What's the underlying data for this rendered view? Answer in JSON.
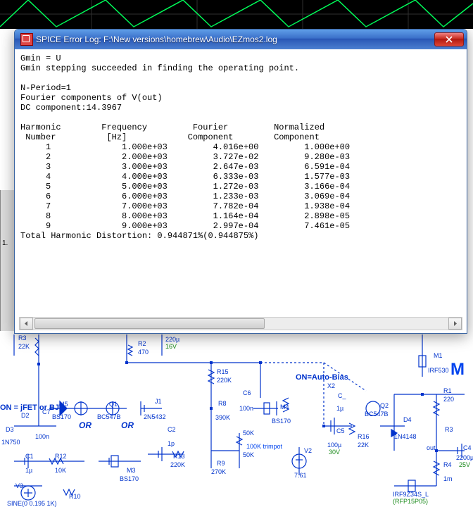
{
  "window": {
    "title": "SPICE Error Log: F:\\New versions\\homebrew\\Audio\\EZmos2.log"
  },
  "log": {
    "gmin": "Gmin = U",
    "gmin_step": "Gmin stepping succeeded in finding the operating point.",
    "nperiod": "N-Period=1",
    "fourier_of": "Fourier components of V(out)",
    "dc": "DC component:14.3967",
    "thd": "Total Harmonic Distortion: 0.944871%(0.944875%)"
  },
  "table": {
    "h1": "Harmonic",
    "h2": "Frequency",
    "h3": "Fourier",
    "h4": "Normalized",
    "u1": " Number",
    "u2": "[Hz]",
    "u3": "Component",
    "u4": "Component",
    "rows": [
      {
        "n": "1",
        "f": "1.000e+03",
        "c": "4.016e+00",
        "r": "1.000e+00"
      },
      {
        "n": "2",
        "f": "2.000e+03",
        "c": "3.727e-02",
        "r": "9.280e-03"
      },
      {
        "n": "3",
        "f": "3.000e+03",
        "c": "2.647e-03",
        "r": "6.591e-04"
      },
      {
        "n": "4",
        "f": "4.000e+03",
        "c": "6.333e-03",
        "r": "1.577e-03"
      },
      {
        "n": "5",
        "f": "5.000e+03",
        "c": "1.272e-03",
        "r": "3.166e-04"
      },
      {
        "n": "6",
        "f": "6.000e+03",
        "c": "1.233e-03",
        "r": "3.069e-04"
      },
      {
        "n": "7",
        "f": "7.000e+03",
        "c": "7.782e-04",
        "r": "1.938e-04"
      },
      {
        "n": "8",
        "f": "8.000e+03",
        "c": "1.164e-04",
        "r": "2.898e-05"
      },
      {
        "n": "9",
        "f": "9.000e+03",
        "c": "2.997e-04",
        "r": "7.461e-05"
      }
    ]
  },
  "scope": {
    "tick1": "1."
  },
  "schem": {
    "r3": "R3",
    "r3v": "22K",
    "r2": "R2",
    "r2v": "470",
    "c_220u": "220µ",
    "c_220uv": "16V",
    "r15": "R15",
    "r15v": "220K",
    "m1": "M1",
    "m1p": "IRF530",
    "autobias": "ON=Auto-Bias",
    "x2": "X2",
    "r1": "R1",
    "r1v": "220",
    "q2": "Q2",
    "q2p": "BC547B",
    "d4": "D4",
    "d4p": "1N4148",
    "r33": "R3",
    "out": "out",
    "c4": "C4",
    "c4v": "2200µ",
    "c4v2": "25V",
    "r4": "R4",
    "r4v": "1m",
    "r16": "R16",
    "r16v": "22K",
    "c5": "C5",
    "c5v": "100µ",
    "c5v2": "30V",
    "v2": "V2",
    "v2v": "7.61",
    "trimpot": "100K trimpot",
    "m4": "M4",
    "m4p": "BS170",
    "r8": "R8",
    "r8v": "390K",
    "c6": "C6",
    "c6v": "100n",
    "c_": "C_",
    "c_v": "1µ",
    "r9": "R9",
    "r9v": "270K",
    "c2": "C2",
    "c2v": "1p",
    "r13": "R13",
    "r13v": "220K",
    "r_50k": "50K",
    "r_50k2": "50K",
    "on_jfet": "ON = jFET or BJT",
    "m5": "M5",
    "m5p": "BS170",
    "q1": "Q1",
    "q1p": "BC547B",
    "j1": "J1",
    "j1p": "2N5432",
    "or": "OR",
    "d2": "D2",
    "d3": "D3",
    "d3p": "1N750",
    "c7": "C7",
    "c7v": "100n",
    "c1": "C1",
    "c1v": "1µ",
    "r12": "R12",
    "r12v": "10K",
    "m3": "M3",
    "m3p": "BS170",
    "r10": "R10",
    "v3": "V3",
    "sine": "SINE(0 0.195 1K)",
    "irfz": "IRF9Z34S_L",
    "rfp": "(RFP15P05)",
    "m_title": "M"
  }
}
